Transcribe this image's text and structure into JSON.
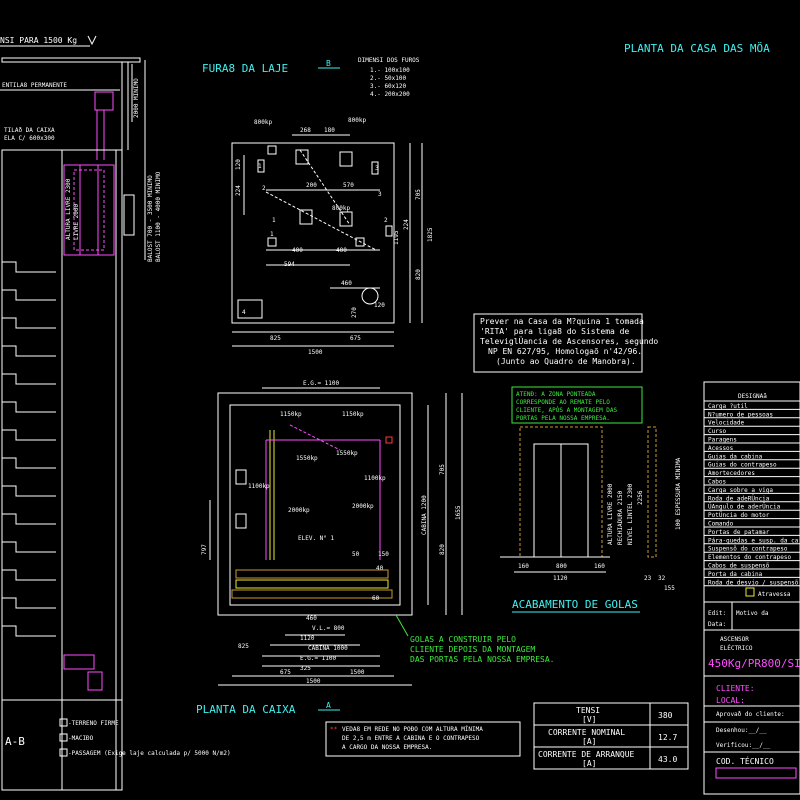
{
  "colors": {
    "background": "#000000",
    "white": "#ffffff",
    "cyan": "#3ef0f0",
    "green": "#3eea3e",
    "red": "#ff3b3b",
    "magenta": "#ff4dff",
    "yellow": "#e8e830"
  },
  "section": {
    "title_fragment": "NSI PARA 1500 Kg",
    "vent_note": "ENTILA8 PERMANENTE",
    "vent_box_1": "TILAð DA CAIXA",
    "vent_box_2": "ELA C/ 600x300",
    "dim_2000": "2000 MINIMO",
    "balost_1": "BALOST 700 - 3500 MINIMO",
    "balost_2": "BALOST 1100 - 4000 MINIMO",
    "cabin_label": "ALTURA LIVRE 2300",
    "cabin_label_2": "LIVRE 2000",
    "plan_label": "A-B",
    "legend": [
      {
        "symbol": "-TERRENO FIRME"
      },
      {
        "symbol": "-MACIÐO"
      },
      {
        "symbol": "-PASSAGEM  (Exige laje calculada p/ 5000 N/m2)"
      }
    ]
  },
  "slab": {
    "title": "FURA8 DA LAJE",
    "marker": "B",
    "holes_title": "DIMENSI DOS FUROS",
    "holes": [
      "1.- 100x100",
      "2.- 50x100",
      "3.- 60x120",
      "4.- 200x200"
    ],
    "loads": [
      "800kp",
      "800kp",
      "800kp"
    ],
    "dims": [
      "268",
      "180",
      "200",
      "570",
      "400",
      "400",
      "594",
      "460",
      "120",
      "270",
      "825",
      "675",
      "1500",
      "1195",
      "820",
      "705",
      "1825",
      "224",
      "224",
      "120"
    ],
    "numbers": [
      "1",
      "2",
      "3",
      "4",
      "3",
      "1",
      "2",
      "1"
    ]
  },
  "machine_room": {
    "title": "PLANTA DA CASA DAS MÖA",
    "note_lines": [
      "Prever na Casa da M?quina 1 tomada",
      "'RITA' para liga8 do Sistema de",
      "TeleviglÜancia de Ascensores, segundo",
      "NP EN 627/95, Homologaõ n'42/96.",
      "(Junto ao Quadro de Manobra)."
    ]
  },
  "shaft_plan": {
    "title": "PLANTA DA CAIXA",
    "marker": "A",
    "eg_top": "E.G.= 1100",
    "loads": [
      "1150kp",
      "1150kp",
      "1550kp",
      "1550kp",
      "1100kp",
      "1100kp",
      "2000kp",
      "2000kp"
    ],
    "elev_label": "ELEV. N° 1",
    "dims": [
      "797",
      "1200",
      "705",
      "1655",
      "820",
      "60",
      "40",
      "50",
      "150",
      "40",
      "60",
      "460",
      "V.L.= 800",
      "1120",
      "CABINA 1000",
      "E.G.= 1100",
      "325",
      "825",
      "675",
      "1500",
      "CABINA 1200"
    ],
    "golas_note": [
      "GOLAS A CONSTRUIR PELO",
      "CLIENTE DEPOIS DA MONTAGEM",
      "DAS PORTAS PELA NOSSA EMPRESA."
    ]
  },
  "door_finish": {
    "title": "ACABAMENTO DE GOLAS",
    "note": [
      "ATENÐ:     A ZONA PONTEADA",
      "CORRESPONDE AO REMATE PELO",
      "CLIENTE, APÓS A MONTAGEM DAS",
      "PORTAS PELA NOSSA EMPRESA."
    ],
    "dims": [
      "ALTURA LIVRE 2000",
      "RECHIADURA 2150",
      "NIVEL LINTEL 2300",
      "2256",
      "100 ESPESSURA MINIMA",
      "160",
      "800",
      "160",
      "1120",
      "23",
      "32",
      "155"
    ]
  },
  "warning": {
    "marker": "**",
    "lines": [
      "VEDA8 EM REDE NO POÐO COM ALTURA MÍNIMA",
      "DE 2,5 m ENTRE A CABINA E O CONTRAPESO",
      "A CARGO DA NOSSA EMPRESA."
    ]
  },
  "electrical": [
    {
      "label": "TENSI\n[V]",
      "l1": "TENSI",
      "l2": "[V]",
      "value": "380"
    },
    {
      "label": "CORRENTE NOMINAL\n[A]",
      "l1": "CORRENTE NOMINAL",
      "l2": "[A]",
      "value": "12.7"
    },
    {
      "label": "CORRENTE DE ARRANQUE\n[A]",
      "l1": "CORRENTE DE ARRANQUE",
      "l2": "[A]",
      "value": "43.0"
    }
  ],
  "title_block": {
    "header": "DESIGNAã",
    "rows": [
      "Carga ?util",
      "N?umero de pessoas",
      "Velocidade",
      "Curso",
      "Paragens",
      "Acessos",
      "Guias da cabina",
      "Guias do contrapeso",
      "Amortecedores",
      "Cabos",
      "Carga sobre a viga",
      "Roda de adeRÜncia",
      "ÜAngulo de aderÜncia",
      "PotÜncia do motor",
      "Comando",
      "Portas de patamar",
      "Pára-quedas e susp. da ca",
      "Suspensõ do contrapeso",
      "Elementos do contrapeso",
      "Cabos de suspensõ",
      "Porta da cabina",
      "Roda de desvio / suspensõ"
    ],
    "atravess": "Atravessa",
    "edit_label": "Edit:",
    "date_label": "Data:",
    "motivo": "Motivo da",
    "product_1": "ASCENSOR",
    "product_2": "ELÉCTRICO",
    "model": "450Kg/PR800/SIMPL",
    "client": "CLIENTE:",
    "local": "LOCAL:",
    "approved": "Aprovað do cliente:",
    "drawn": "Desenhou:__/__",
    "checked": "Verificou:__/__",
    "code": "COD. TÉCNICO"
  }
}
